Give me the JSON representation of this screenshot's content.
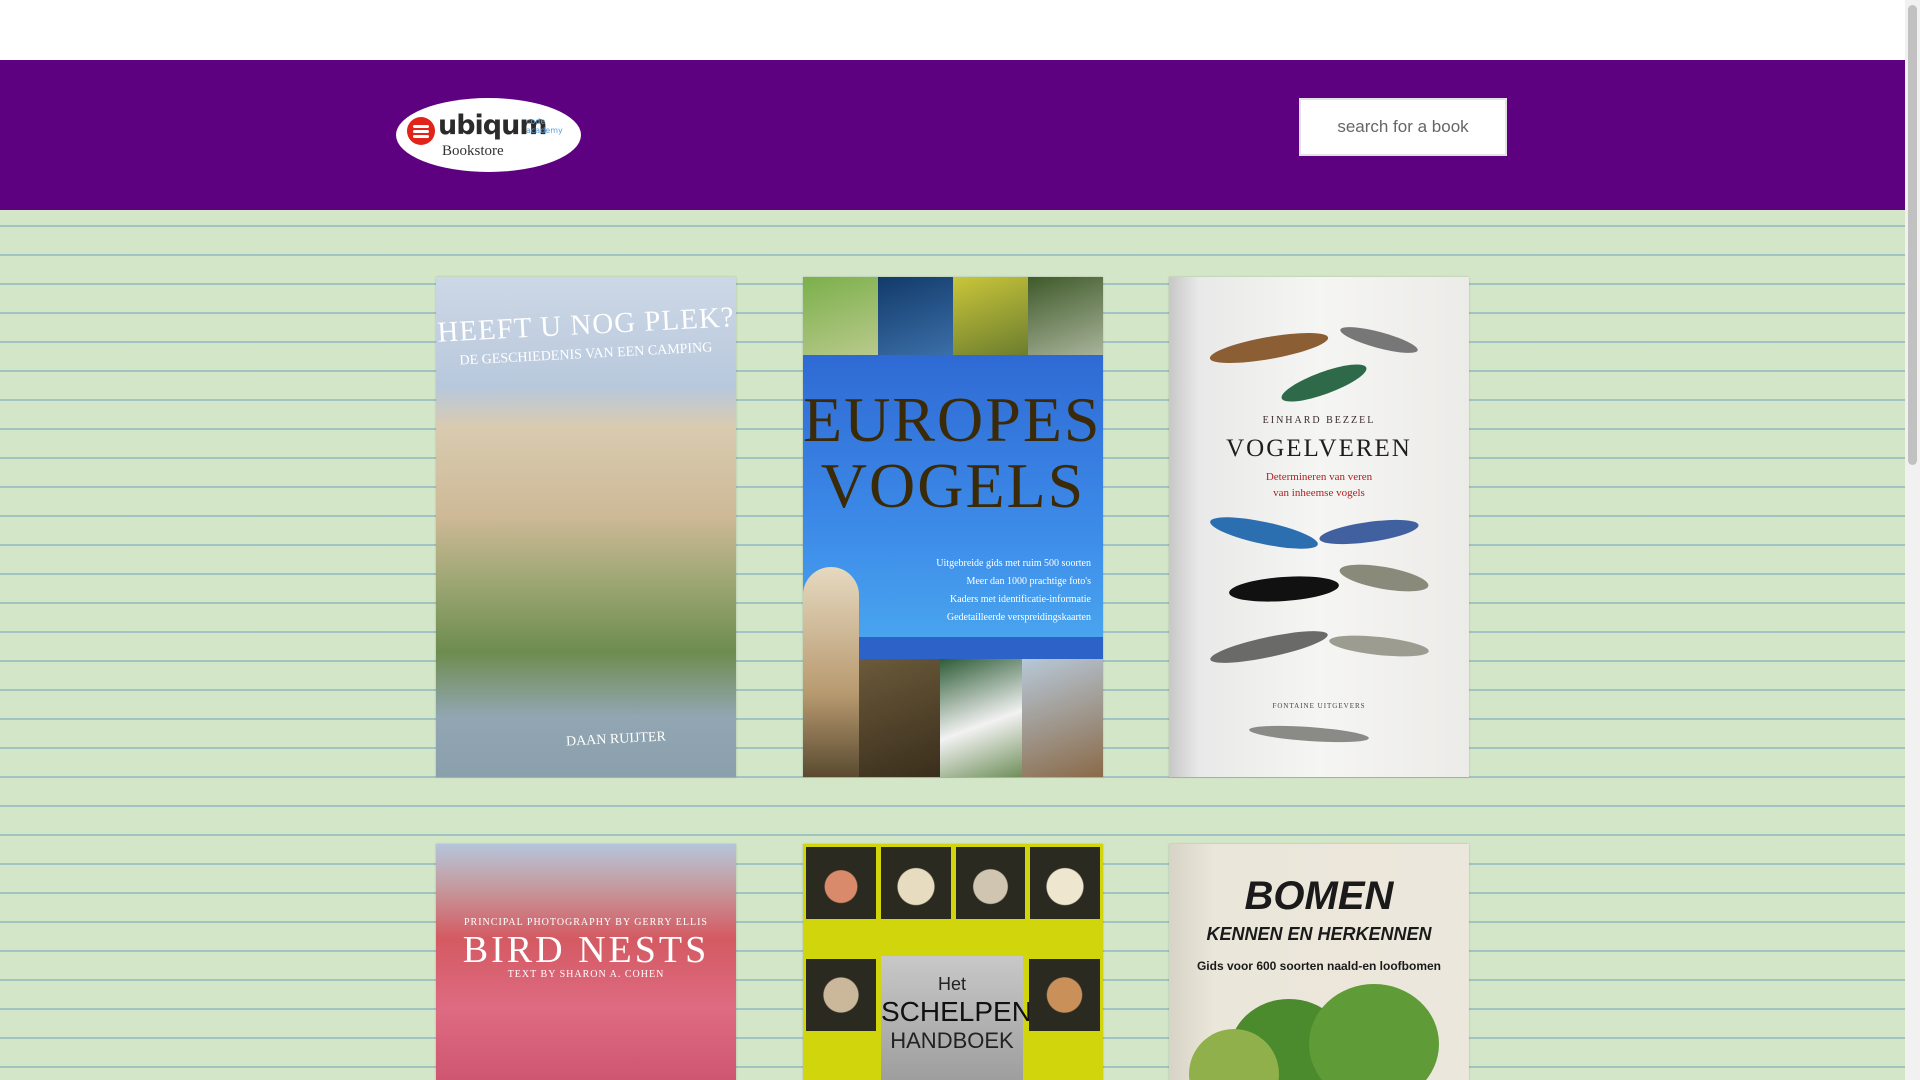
{
  "header": {
    "logo": {
      "wordmark": "ubiqum",
      "tagline_1": "code",
      "tagline_2": "academy",
      "subtitle": "Bookstore"
    },
    "search": {
      "placeholder": "search for a book",
      "value": ""
    }
  },
  "books": [
    {
      "title": "HEEFT U NOG PLEK?",
      "subtitle": "DE GESCHIEDENIS VAN EEN CAMPING",
      "author": "DAAN RUIJTER"
    },
    {
      "title_line_1": "EUROPESE",
      "title_line_2": "VOGELS",
      "features": [
        "Uitgebreide gids met ruim 500 soorten",
        "Meer dan 1000 prachtige foto's",
        "Kaders met identificatie-informatie",
        "Gedetailleerde verspreidingskaarten"
      ]
    },
    {
      "author": "EINHARD BEZZEL",
      "title": "VOGELVEREN",
      "subtitle_line_1": "Determineren van veren",
      "subtitle_line_2": "van inheemse vogels",
      "publisher": "FONTAINE UITGEVERS"
    },
    {
      "credit": "PRINCIPAL PHOTOGRAPHY BY GERRY ELLIS",
      "title": "BIRD NESTS",
      "text_by": "TEXT BY SHARON A. COHEN"
    },
    {
      "title_line_1": "Het",
      "title_line_2": "SCHELPEN",
      "title_line_3": "HANDBOEK"
    },
    {
      "title": "BOMEN",
      "subtitle": "KENNEN EN HERKENNEN",
      "tagline": "Gids voor 600 soorten naald-en loofbomen"
    }
  ],
  "colors": {
    "header_bg": "#5e0180",
    "page_bg": "#d3e7c8",
    "brand_red": "#e2231a"
  }
}
